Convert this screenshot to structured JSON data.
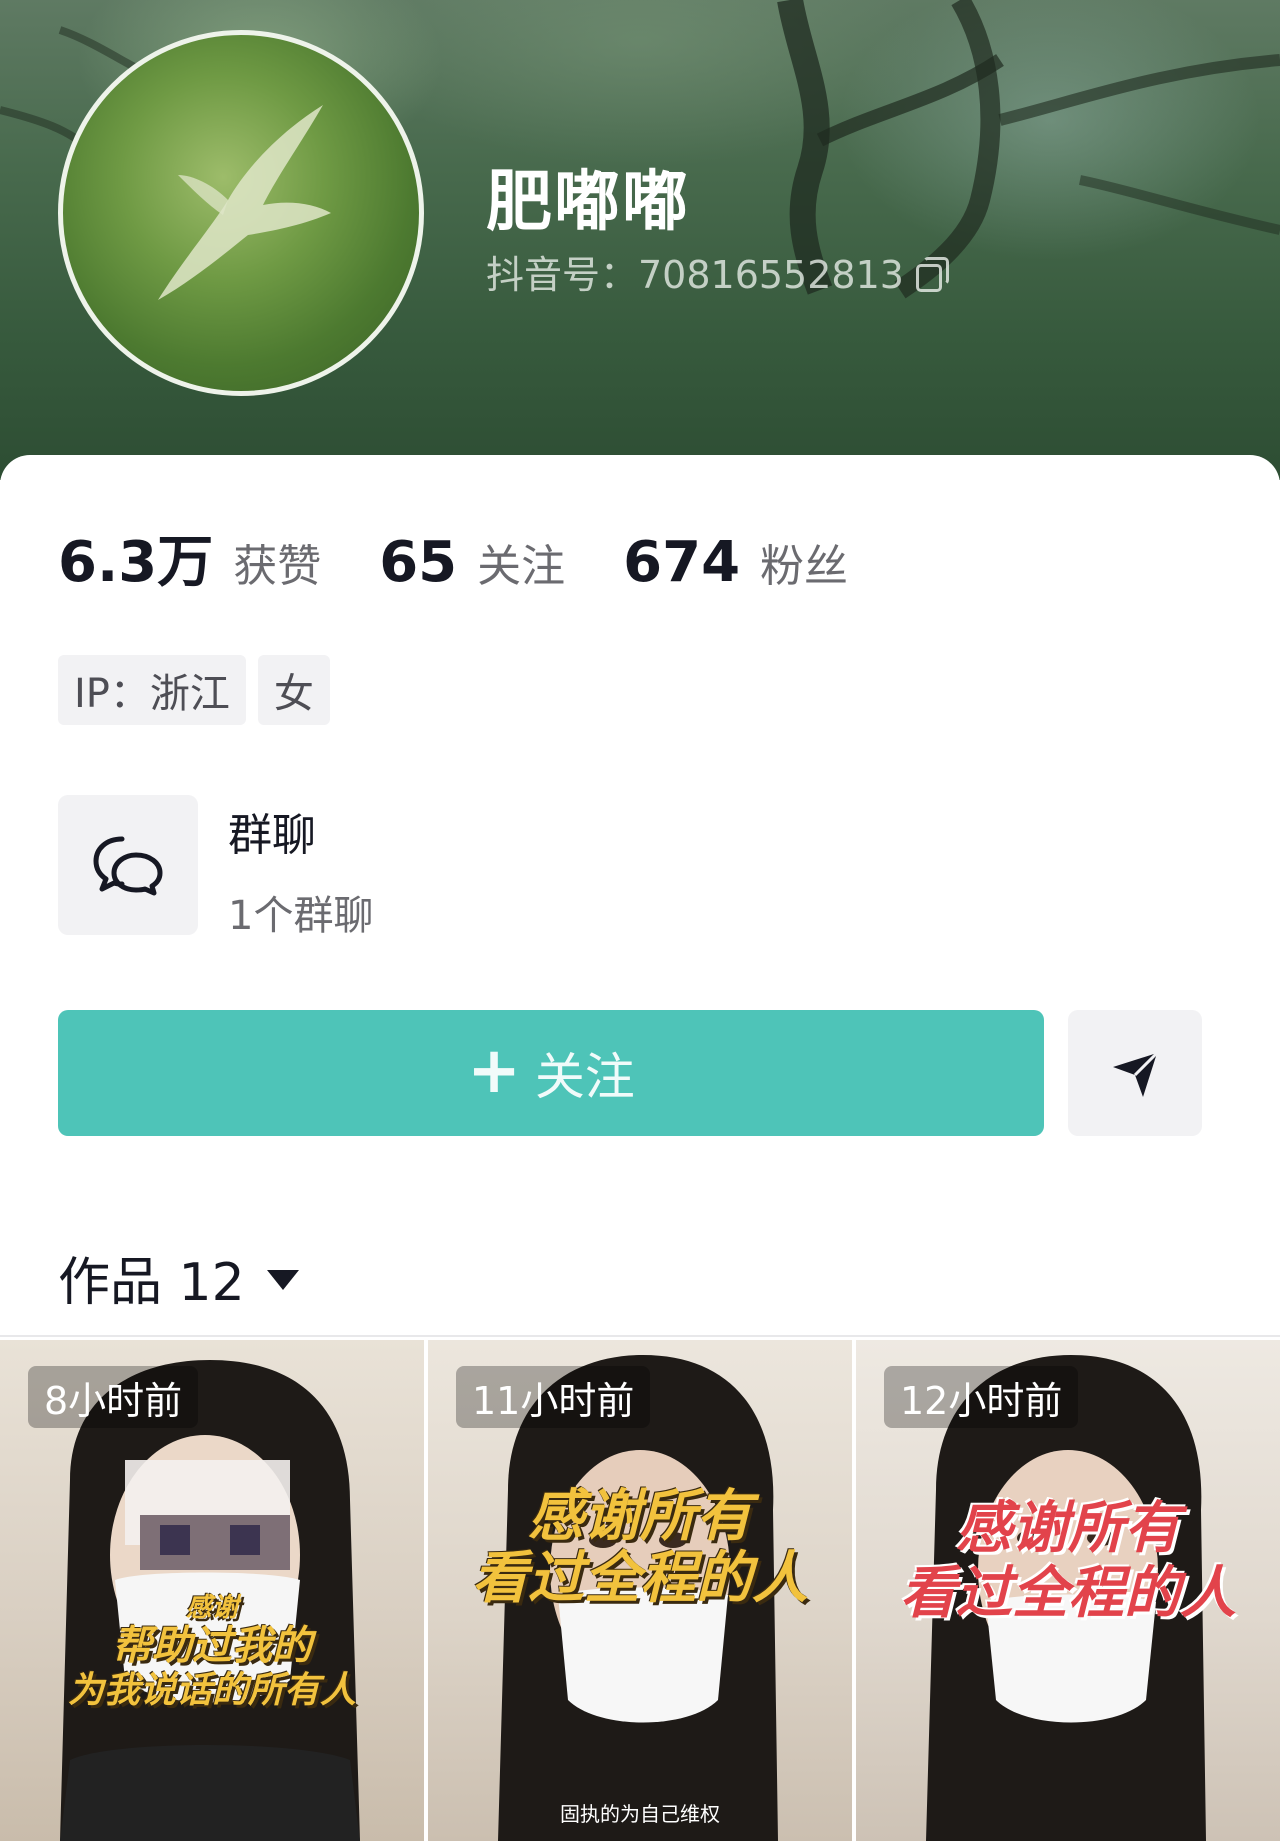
{
  "profile": {
    "nickname": "肥嘟嘟",
    "douyin_id_label": "抖音号：70816552813"
  },
  "stats": [
    {
      "value": "6.3万",
      "label": "获赞"
    },
    {
      "value": "65",
      "label": "关注"
    },
    {
      "value": "674",
      "label": "粉丝"
    }
  ],
  "tags": [
    "IP：浙江",
    "女"
  ],
  "group_chat": {
    "title": "群聊",
    "subtitle": "1个群聊"
  },
  "actions": {
    "follow_label": "关注",
    "plus_icon": "+",
    "share_icon": "send-icon"
  },
  "works_tab": {
    "label": "作品 12"
  },
  "videos": [
    {
      "time": "8小时前",
      "caption_line1": "感谢",
      "caption_line2": "帮助过我的",
      "caption_line3": "为我说话的所有人",
      "caption_color": "#f2c23d"
    },
    {
      "time": "11小时前",
      "caption_line1": "感谢所有",
      "caption_line2": "看过全程的人",
      "subtitle": "固执的为自己维权",
      "caption_color": "#f2c23d"
    },
    {
      "time": "12小时前",
      "caption_line1": "感谢所有",
      "caption_line2": "看过全程的人",
      "caption_color": "#e2434b"
    }
  ],
  "colors": {
    "follow_button": "#4ec4b8",
    "cover_green": "#375a3d"
  }
}
